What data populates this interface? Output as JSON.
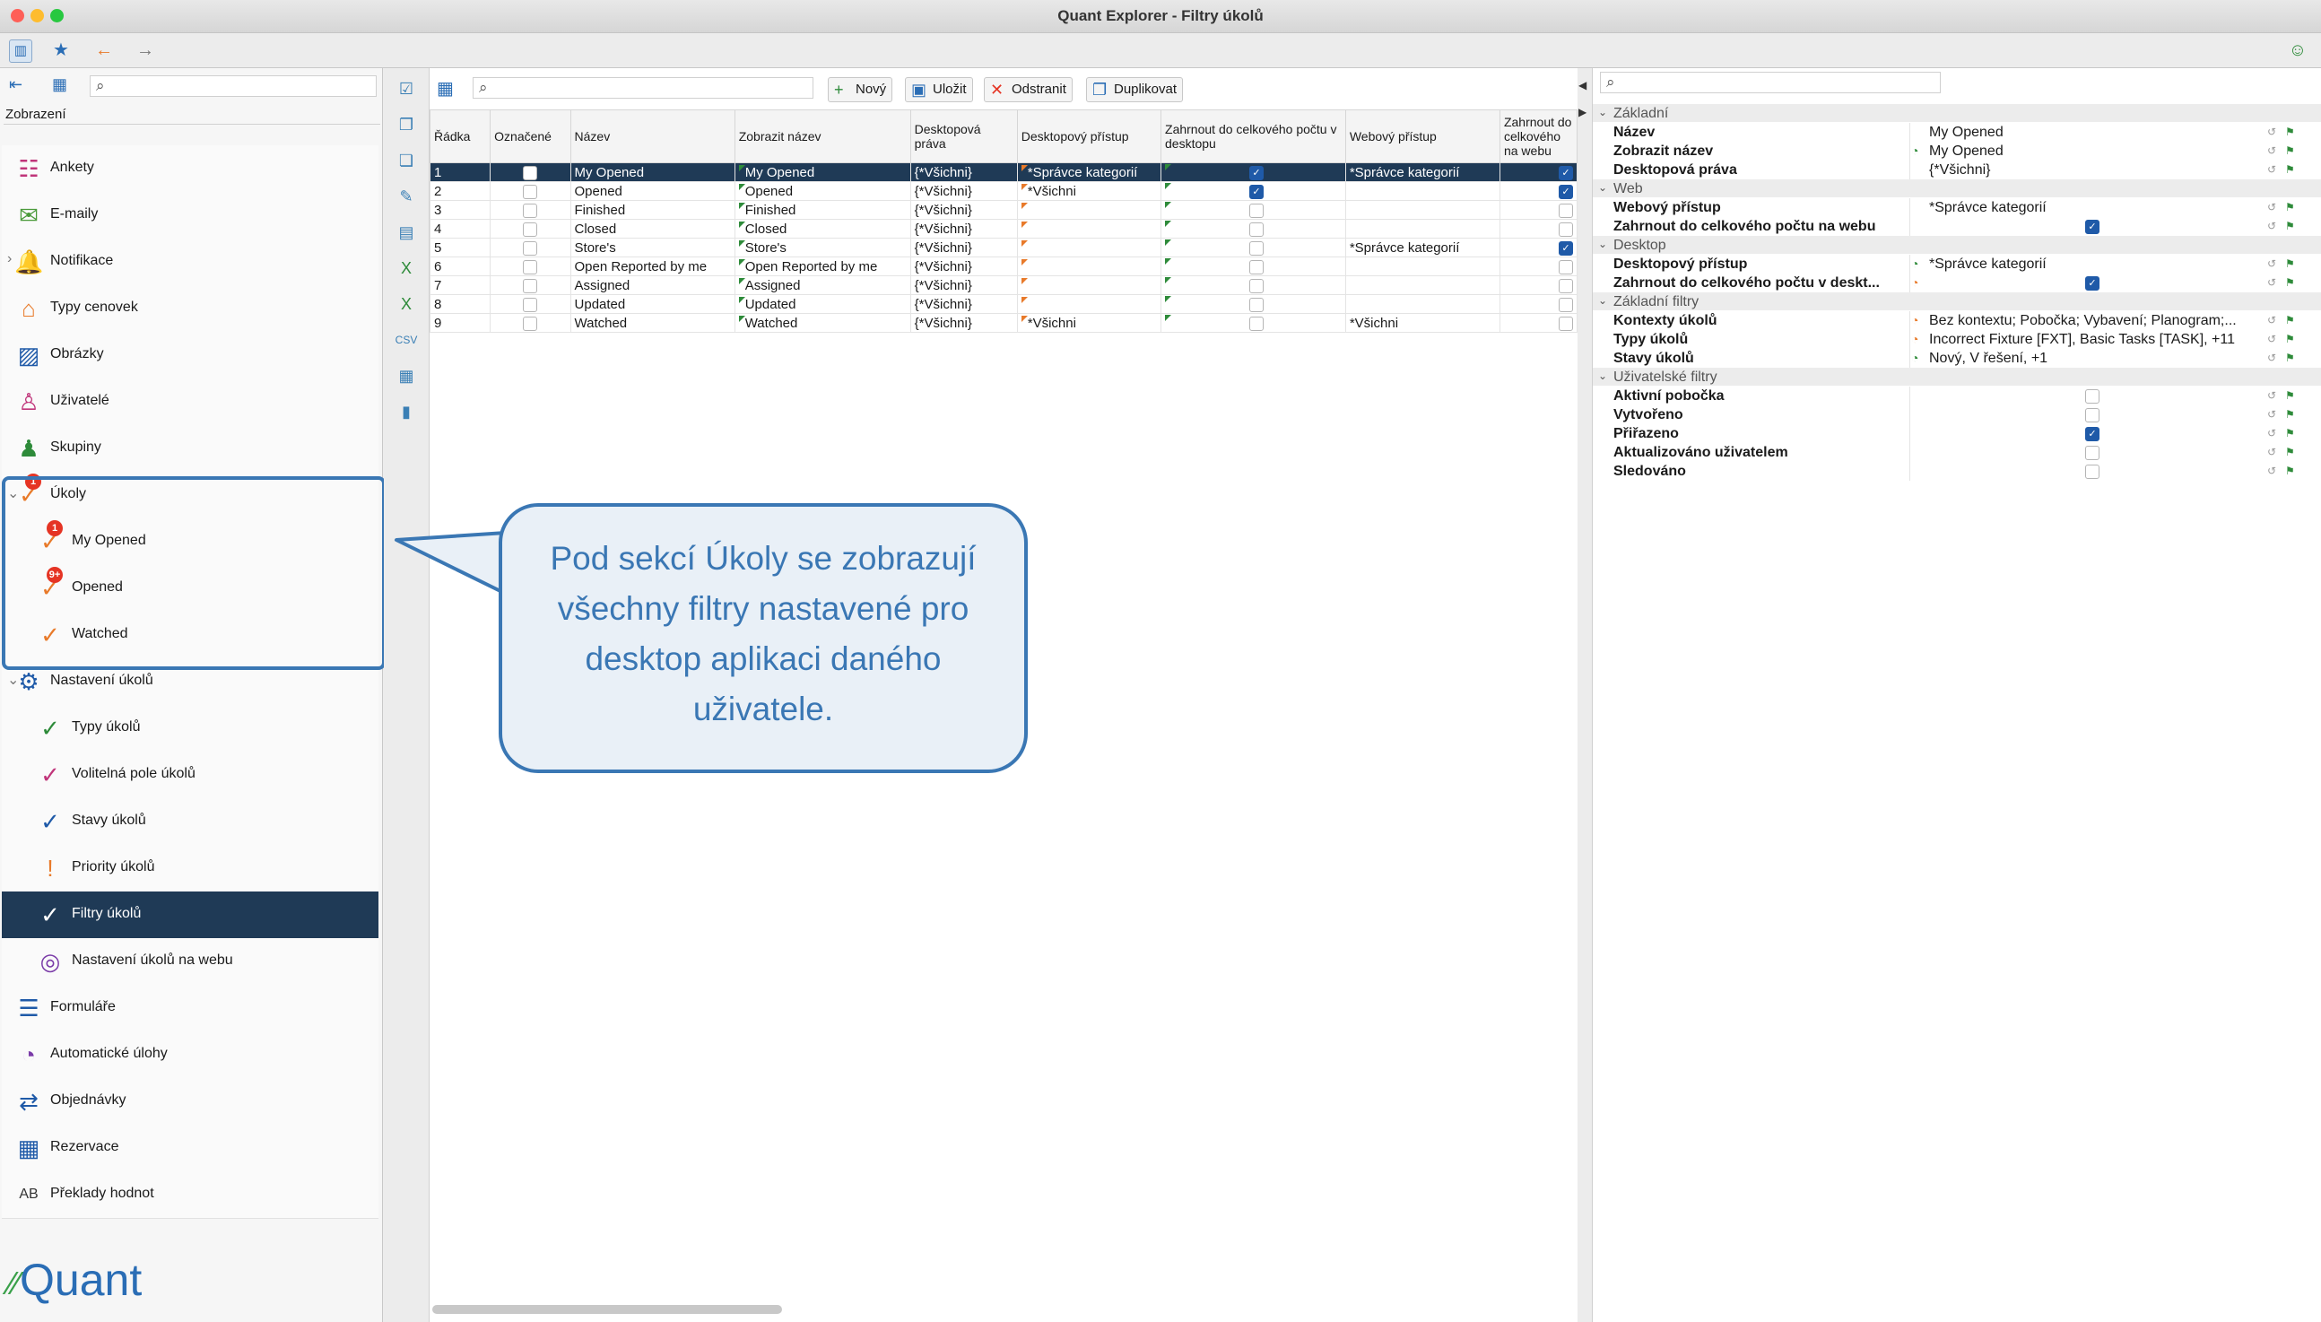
{
  "window": {
    "title": "Quant Explorer - Filtry úkolů"
  },
  "sidebar": {
    "header": "Zobrazení",
    "items": [
      {
        "label": "Ankety",
        "icon": "survey-icon",
        "color": "#c0357a"
      },
      {
        "label": "E-maily",
        "icon": "envelope-icon",
        "color": "#4a9a3a"
      },
      {
        "label": "Notifikace",
        "icon": "bell-icon",
        "color": "#1f5aa8"
      },
      {
        "label": "Typy cenovek",
        "icon": "price-tag-icon",
        "color": "#e87a2a"
      },
      {
        "label": "Obrázky",
        "icon": "image-icon",
        "color": "#1f5aa8"
      },
      {
        "label": "Uživatelé",
        "icon": "user-icon",
        "color": "#c0357a"
      },
      {
        "label": "Skupiny",
        "icon": "group-icon",
        "color": "#2e8b3a"
      },
      {
        "label": "Úkoly",
        "icon": "task-check-icon",
        "color": "#e87a2a",
        "badge": "1"
      },
      {
        "label": "My Opened",
        "icon": "task-check-icon",
        "color": "#e87a2a",
        "badge": "1"
      },
      {
        "label": "Opened",
        "icon": "task-check-icon",
        "color": "#e87a2a",
        "badge": "9+"
      },
      {
        "label": "Watched",
        "icon": "task-check-icon",
        "color": "#e87a2a"
      },
      {
        "label": "Nastavení úkolů",
        "icon": "task-settings-icon",
        "color": "#1f5aa8"
      },
      {
        "label": "Typy úkolů",
        "icon": "task-types-icon",
        "color": "#2e8b3a"
      },
      {
        "label": "Volitelná pole úkolů",
        "icon": "task-fields-icon",
        "color": "#c0357a"
      },
      {
        "label": "Stavy úkolů",
        "icon": "task-states-icon",
        "color": "#1f5aa8"
      },
      {
        "label": "Priority úkolů",
        "icon": "task-priority-icon",
        "color": "#e87a2a"
      },
      {
        "label": "Filtry úkolů",
        "icon": "task-filter-icon",
        "color": "#ffffff"
      },
      {
        "label": "Nastavení úkolů na webu",
        "icon": "task-web-icon",
        "color": "#7a3aa8"
      },
      {
        "label": "Formuláře",
        "icon": "form-icon",
        "color": "#1f5aa8"
      },
      {
        "label": "Automatické úlohy",
        "icon": "clock-icon",
        "color": "#7a3aa8"
      },
      {
        "label": "Objednávky",
        "icon": "order-icon",
        "color": "#1f5aa8"
      },
      {
        "label": "Rezervace",
        "icon": "calendar-icon",
        "color": "#1f5aa8"
      },
      {
        "label": "Překlady hodnot",
        "icon": "translate-icon",
        "color": "#333333"
      }
    ],
    "logo": "Quant"
  },
  "toolbar": {
    "new": "Nový",
    "save": "Uložit",
    "delete": "Odstranit",
    "duplicate": "Duplikovat"
  },
  "grid": {
    "headers": [
      "Řádka",
      "Označené",
      "Název",
      "Zobrazit název",
      "Desktopová práva",
      "Desktopový přístup",
      "Zahrnout do celkového počtu v desktopu",
      "Webový přístup",
      "Zahrnout do celkového na webu"
    ],
    "rows": [
      {
        "n": "1",
        "name": "My Opened",
        "display": "My Opened",
        "rights": "{*Všichni}",
        "desk": "*Správce kategorií",
        "incDesk": true,
        "web": "*Správce kategorií",
        "incWeb": true
      },
      {
        "n": "2",
        "name": "Opened",
        "display": "Opened",
        "rights": "{*Všichni}",
        "desk": "*Všichni",
        "incDesk": true,
        "web": "",
        "incWeb": true
      },
      {
        "n": "3",
        "name": "Finished",
        "display": "Finished",
        "rights": "{*Všichni}",
        "desk": "",
        "incDesk": false,
        "web": "",
        "incWeb": false
      },
      {
        "n": "4",
        "name": "Closed",
        "display": "Closed",
        "rights": "{*Všichni}",
        "desk": "",
        "incDesk": false,
        "web": "",
        "incWeb": false
      },
      {
        "n": "5",
        "name": "Store's",
        "display": "Store's",
        "rights": "{*Všichni}",
        "desk": "",
        "incDesk": false,
        "web": "*Správce kategorií",
        "incWeb": true
      },
      {
        "n": "6",
        "name": "Open Reported by me",
        "display": "Open Reported by me",
        "rights": "{*Všichni}",
        "desk": "",
        "incDesk": false,
        "web": "",
        "incWeb": false
      },
      {
        "n": "7",
        "name": "Assigned",
        "display": "Assigned",
        "rights": "{*Všichni}",
        "desk": "",
        "incDesk": false,
        "web": "",
        "incWeb": false
      },
      {
        "n": "8",
        "name": "Updated",
        "display": "Updated",
        "rights": "{*Všichni}",
        "desk": "",
        "incDesk": false,
        "web": "",
        "incWeb": false
      },
      {
        "n": "9",
        "name": "Watched",
        "display": "Watched",
        "rights": "{*Všichni}",
        "desk": "*Všichni",
        "incDesk": false,
        "web": "*Všichni",
        "incWeb": false
      }
    ]
  },
  "properties": {
    "sections": [
      {
        "title": "Základní",
        "rows": [
          {
            "key": "Název",
            "value": "My Opened"
          },
          {
            "key": "Zobrazit název",
            "value": "My Opened",
            "icon": "green"
          },
          {
            "key": "Desktopová práva",
            "value": "{*Všichni}"
          }
        ]
      },
      {
        "title": "Web",
        "rows": [
          {
            "key": "Webový přístup",
            "value": "*Správce kategorií"
          },
          {
            "key": "Zahrnout do celkového počtu na webu",
            "value": "",
            "check": true
          }
        ]
      },
      {
        "title": "Desktop",
        "rows": [
          {
            "key": "Desktopový přístup",
            "value": "*Správce kategorií",
            "icon": "green"
          },
          {
            "key": "Zahrnout do celkového počtu v deskt...",
            "value": "",
            "check": true,
            "icon": "orange"
          }
        ]
      },
      {
        "title": "Základní filtry",
        "rows": [
          {
            "key": "Kontexty úkolů",
            "value": "Bez kontextu; Pobočka; Vybavení; Planogram;...",
            "icon": "orange"
          },
          {
            "key": "Typy úkolů",
            "value": "Incorrect Fixture [FXT], Basic Tasks [TASK], +11",
            "icon": "orange"
          },
          {
            "key": "Stavy úkolů",
            "value": "Nový, V řešení, +1",
            "icon": "green"
          }
        ]
      },
      {
        "title": "Uživatelské filtry",
        "rows": [
          {
            "key": "Aktivní pobočka",
            "value": "",
            "check": false
          },
          {
            "key": "Vytvořeno",
            "value": "",
            "check": false
          },
          {
            "key": "Přiřazeno",
            "value": "",
            "check": true
          },
          {
            "key": "Aktualizováno uživatelem",
            "value": "",
            "check": false
          },
          {
            "key": "Sledováno",
            "value": "",
            "check": false
          }
        ]
      }
    ]
  },
  "callout": {
    "text": "Pod sekcí Úkoly se zobrazují všechny filtry nastavené pro desktop aplikaci daného uživatele."
  },
  "colors": {
    "accent": "#3a77b4",
    "selected": "#1f3a56",
    "callout_bg": "#e9f0f7"
  }
}
